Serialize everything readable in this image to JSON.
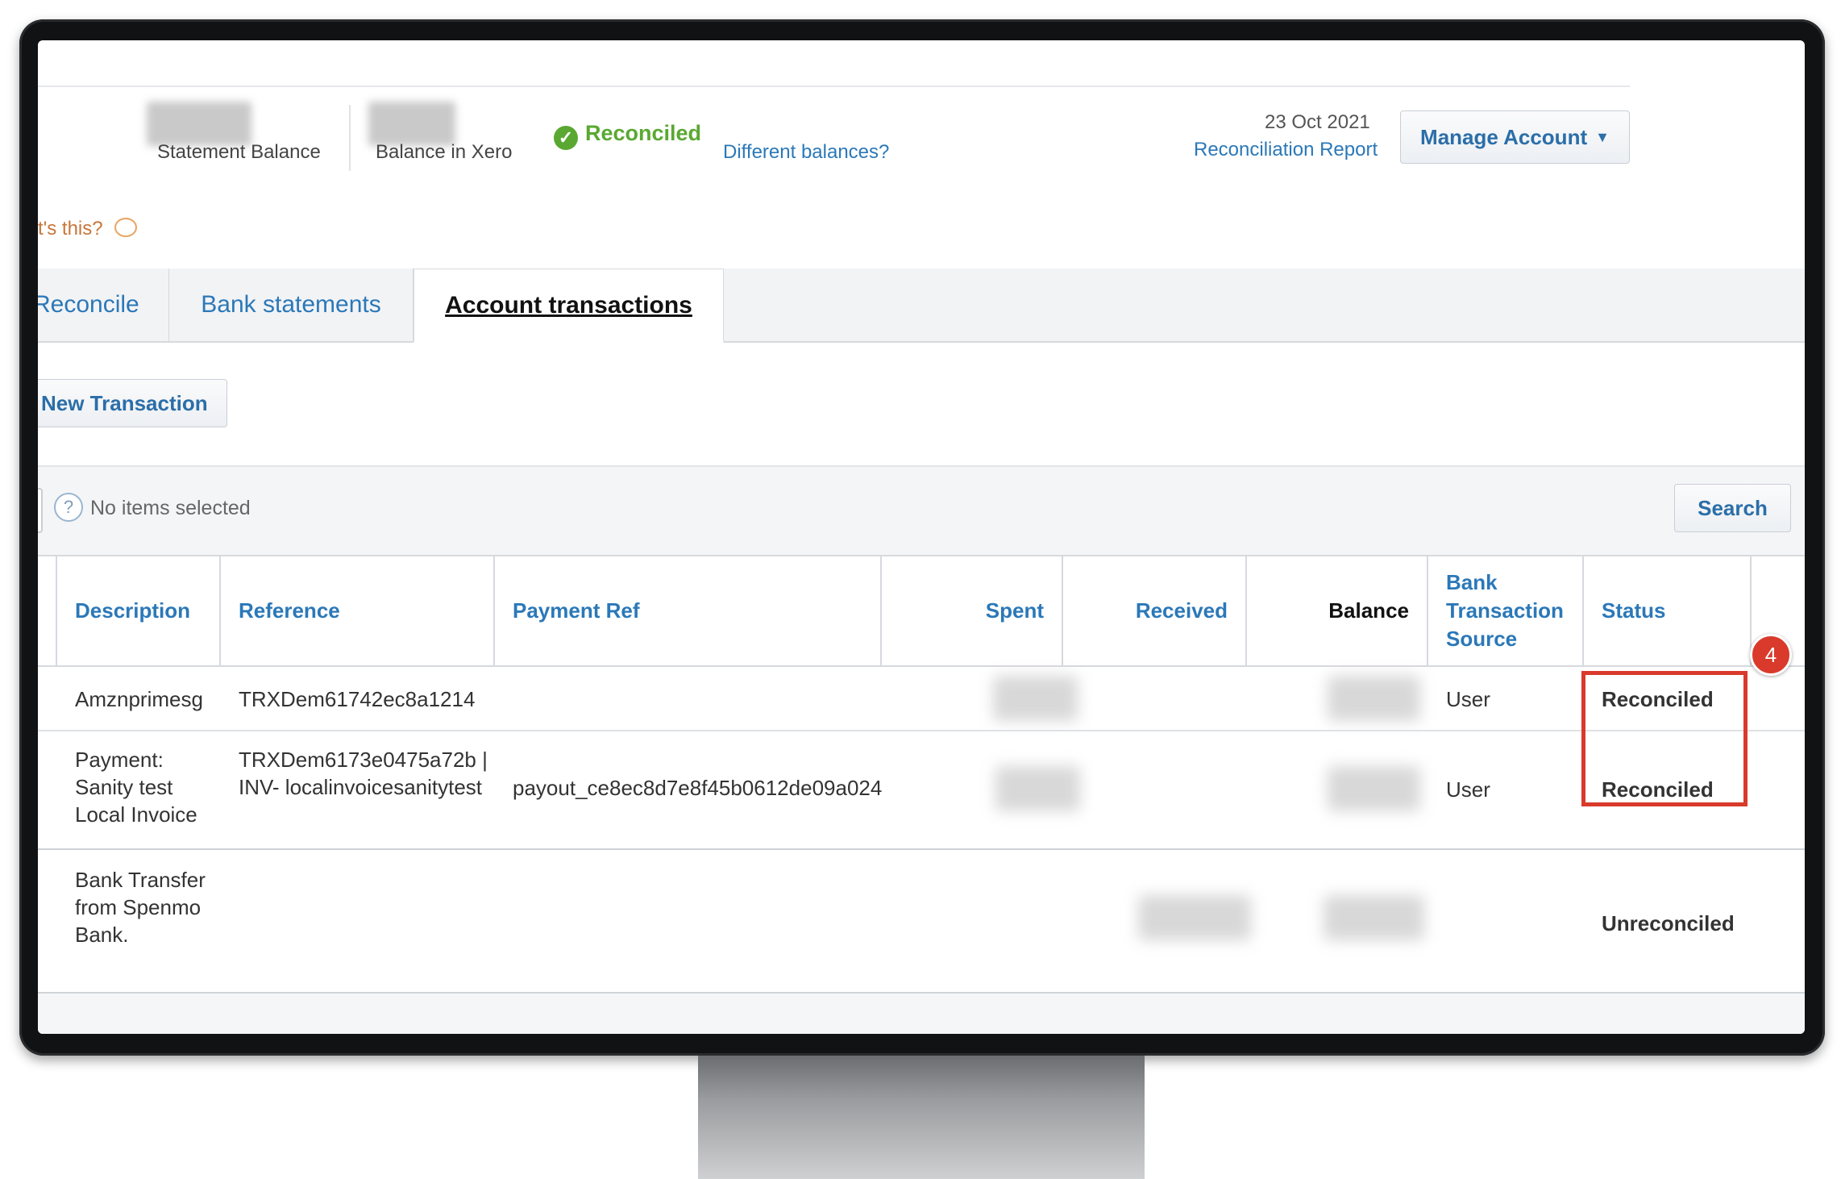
{
  "header": {
    "statement_balance_label": "Statement Balance",
    "balance_in_xero_label": "Balance in Xero",
    "reconciled_status": "Reconciled",
    "different_balances_link": "Different balances?",
    "report_date": "23 Oct 2021",
    "reconciliation_report_link": "Reconciliation Report",
    "manage_account_label": "Manage Account",
    "whats_this": "t's this?"
  },
  "tabs": [
    {
      "label": "Reconcile"
    },
    {
      "label": "Bank statements"
    },
    {
      "label": "Account transactions",
      "active": true
    }
  ],
  "toolbar": {
    "new_transaction_label": "New Transaction",
    "selection_text": "No items selected",
    "search_label": "Search"
  },
  "table": {
    "columns": [
      "Description",
      "Reference",
      "Payment Ref",
      "Spent",
      "Received",
      "Balance",
      "Bank Transaction Source",
      "Status"
    ],
    "rows": [
      {
        "description": "Amznprimesg",
        "reference": "TRXDem61742ec8a1214",
        "payment_ref": "",
        "source": "User",
        "status": "Reconciled"
      },
      {
        "description": "Payment: Sanity test Local Invoice",
        "reference": "TRXDem6173e0475a72b | INV- localinvoicesanitytest",
        "payment_ref": "payout_ce8ec8d7e8f45b0612de09a024",
        "source": "User",
        "status": "Reconciled"
      },
      {
        "description": "Bank Transfer from Spenmo Bank.",
        "reference": "",
        "payment_ref": "",
        "source": "",
        "status": "Unreconciled"
      }
    ]
  },
  "annotation": {
    "step_number": "4",
    "highlight_color": "#d93a2b"
  },
  "colors": {
    "link": "#2b78b8",
    "reconciled": "#5aa832",
    "unreconciled": "#e9732a"
  }
}
